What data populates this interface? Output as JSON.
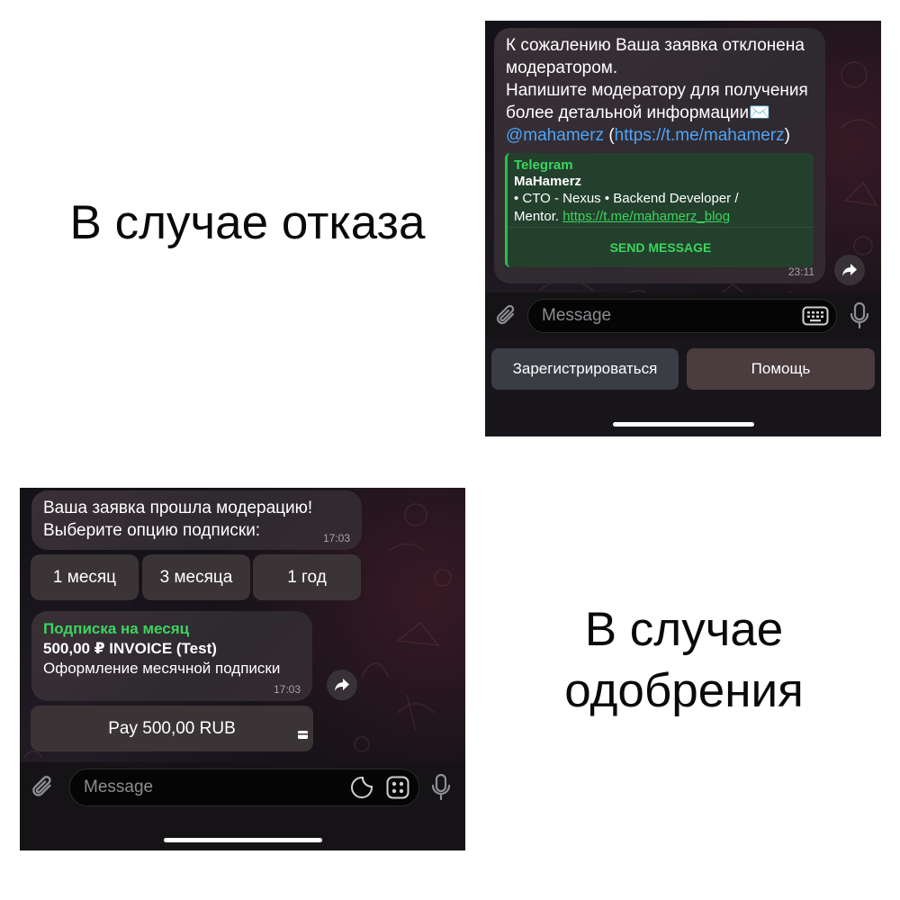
{
  "captions": {
    "reject": "В случае отказа",
    "approve_line1": "В случае",
    "approve_line2": "одобрения"
  },
  "reject_chat": {
    "message": {
      "line1": "К сожалению Ваша заявка отклонена",
      "line2": "модератором.",
      "line3": "Напишите модератору для получения",
      "line4": "более детальной информации✉️",
      "mention": "@mahamerz",
      "open_paren": " (",
      "url": "https://t.me/mahamerz",
      "close_paren": ")",
      "time": "23:11"
    },
    "preview": {
      "site": "Telegram",
      "title": "MaHamerz",
      "desc_line1": "• CTO - Nexus • Backend Developer /",
      "desc_prefix": "Mentor. ",
      "desc_link": "https://t.me/mahamerz_blog",
      "button": "SEND MESSAGE"
    },
    "input_placeholder": "Message",
    "keyboard": {
      "register": "Зарегистрироваться",
      "help": "Помощь"
    }
  },
  "approve_chat": {
    "message": {
      "line1": "Ваша заявка прошла модерацию!",
      "line2": "Выберите опцию подписки:",
      "time": "17:03"
    },
    "options": [
      "1 месяц",
      "3 месяца",
      "1 год"
    ],
    "invoice": {
      "title": "Подписка на месяц",
      "amount": "500,00 ₽ INVOICE (Test)",
      "description": "Оформление месячной подписки",
      "time": "17:03",
      "pay_button": "Pay 500,00 RUB"
    },
    "input_placeholder": "Message"
  },
  "colors": {
    "accent_green": "#3bd45f",
    "link_blue": "#4ea4f6"
  }
}
